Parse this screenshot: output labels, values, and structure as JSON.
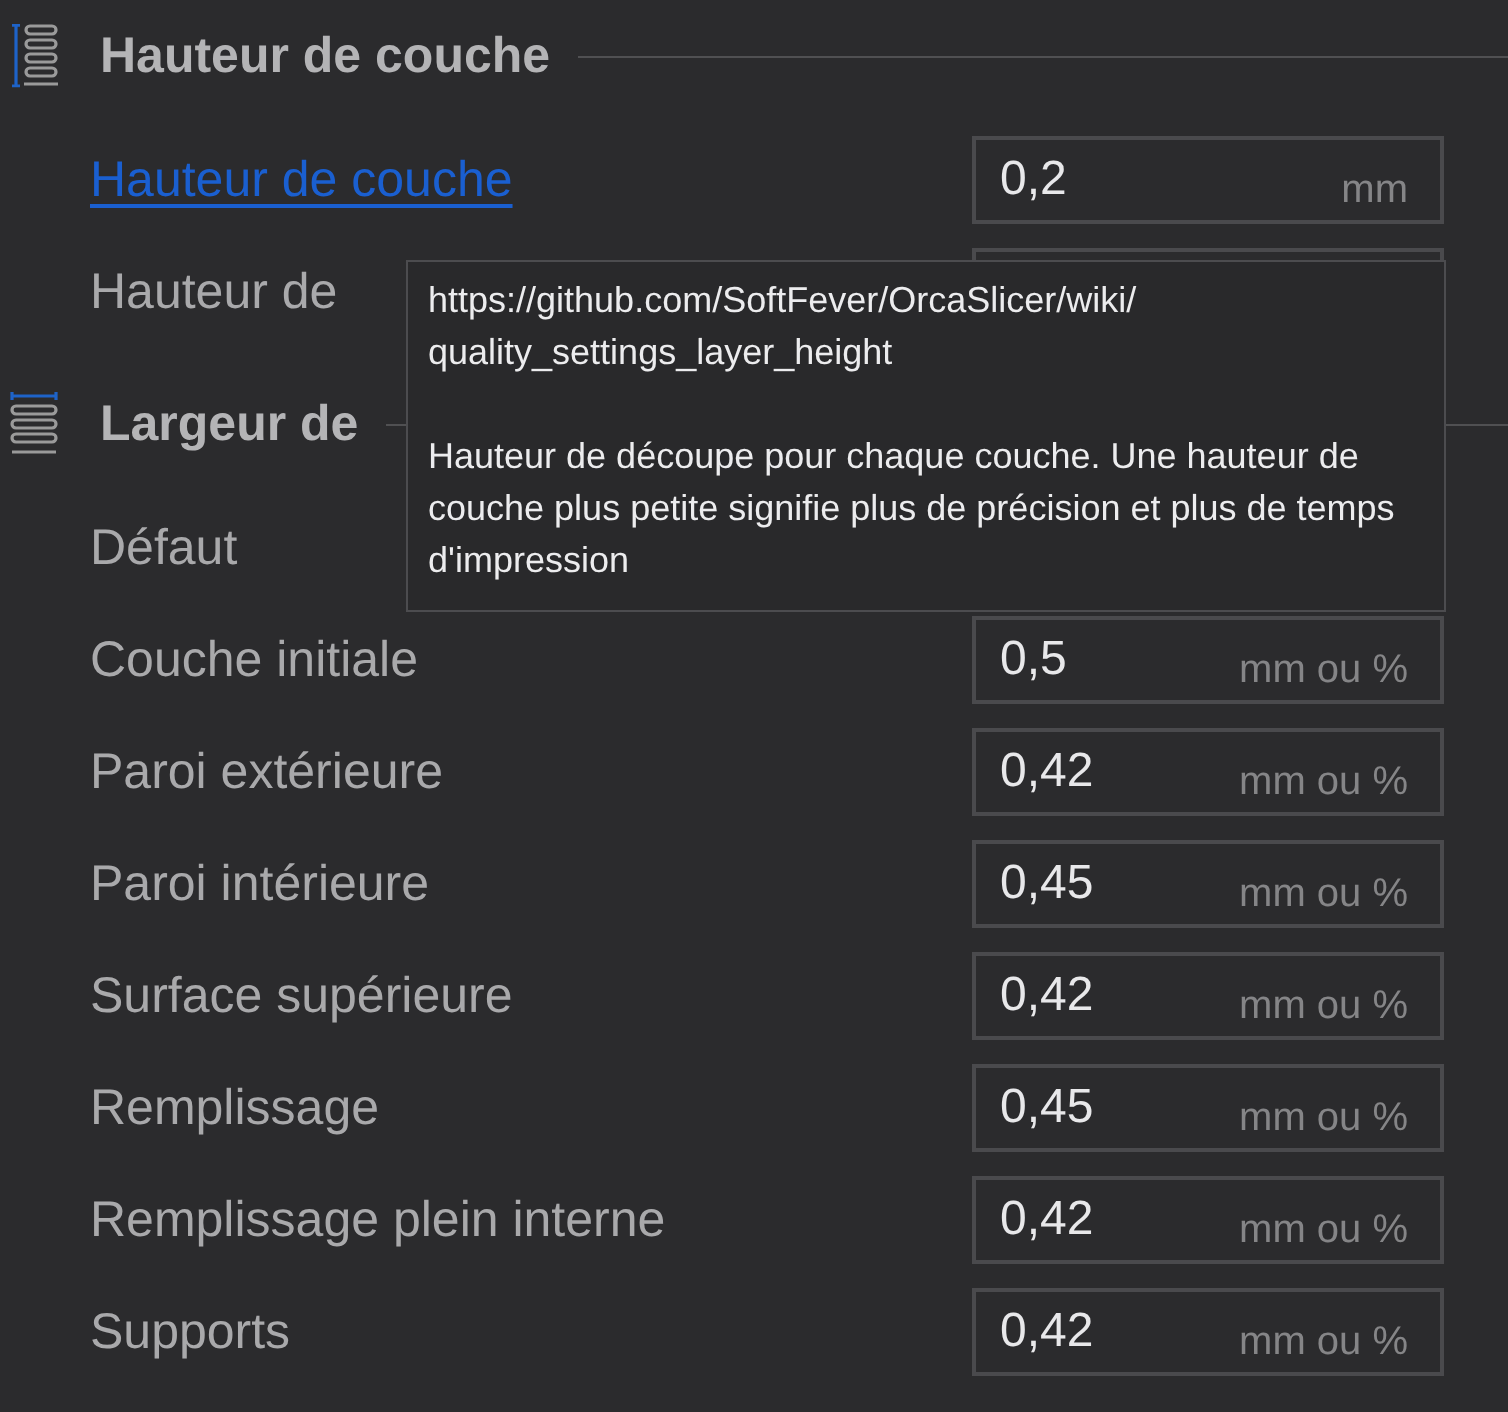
{
  "sections": [
    {
      "title": "Hauteur de couche",
      "kind": "height",
      "rows": [
        {
          "label": "Hauteur de couche",
          "kind": "link",
          "value": "0,2",
          "unit": "mm"
        },
        {
          "label": "Hauteur de",
          "kind": "plain",
          "field": true
        }
      ]
    },
    {
      "title": "Largeur de",
      "kind": "width",
      "rows": [
        {
          "label": "Défaut",
          "kind": "plain"
        },
        {
          "label": "Couche initiale",
          "kind": "plain",
          "value": "0,5",
          "unit": "mm ou %"
        },
        {
          "label": "Paroi extérieure",
          "kind": "plain",
          "value": "0,42",
          "unit": "mm ou %"
        },
        {
          "label": "Paroi intérieure",
          "kind": "plain",
          "value": "0,45",
          "unit": "mm ou %"
        },
        {
          "label": "Surface supérieure",
          "kind": "plain",
          "value": "0,42",
          "unit": "mm ou %"
        },
        {
          "label": "Remplissage",
          "kind": "plain",
          "value": "0,45",
          "unit": "mm ou %"
        },
        {
          "label": "Remplissage plein interne",
          "kind": "plain",
          "value": "0,42",
          "unit": "mm ou %"
        },
        {
          "label": "Supports",
          "kind": "plain",
          "value": "0,42",
          "unit": "mm ou %"
        }
      ]
    }
  ],
  "tooltip": {
    "url_lines": [
      "https://github.com/SoftFever/OrcaSlicer/wiki/",
      "quality_settings_layer_height"
    ],
    "text": "Hauteur de découpe pour chaque couche. Une hauteur de couche plus petite signifie plus de précision et plus de temps d'impression"
  }
}
